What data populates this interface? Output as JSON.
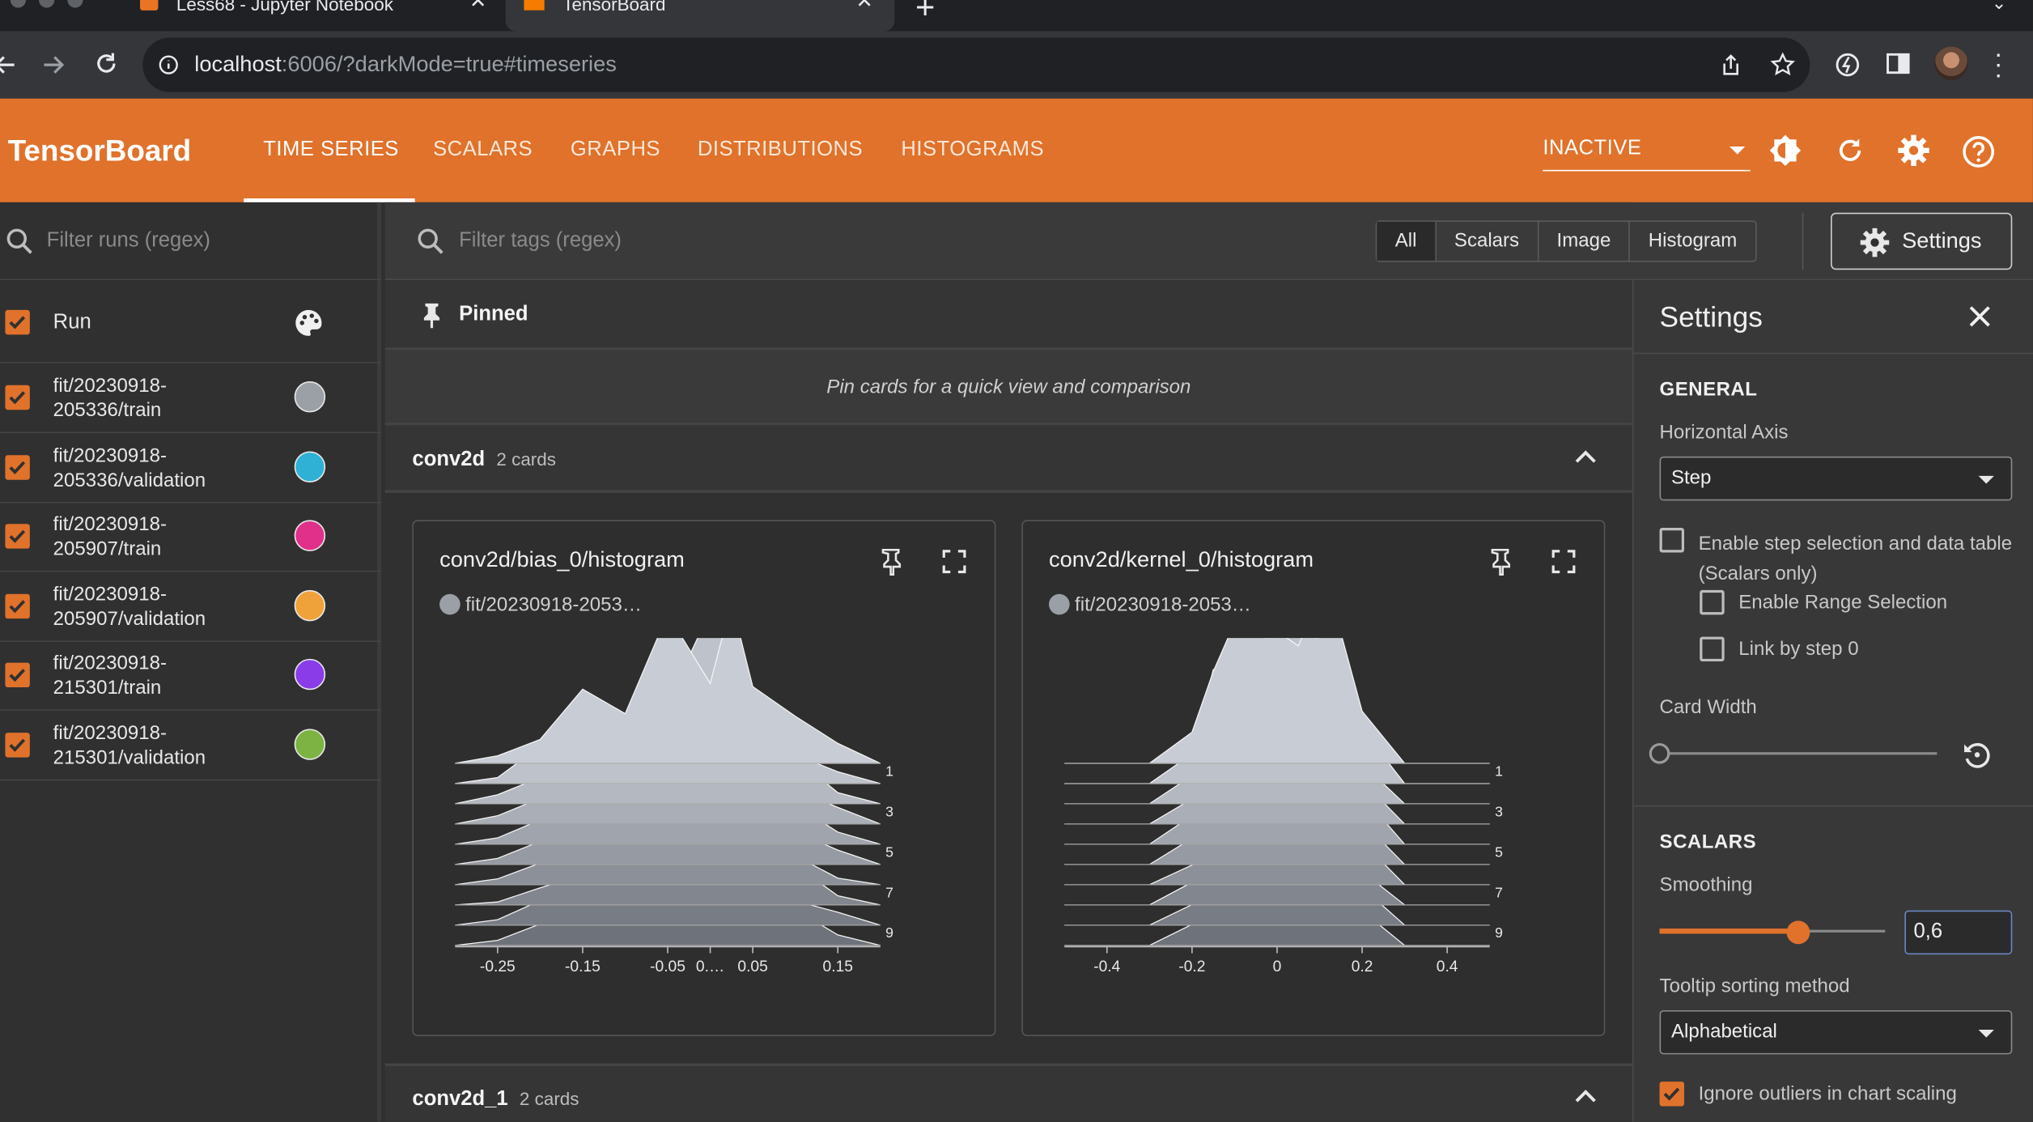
{
  "browser": {
    "tabs": [
      {
        "title": "Less68 - Jupyter Notebook"
      },
      {
        "title": "TensorBoard"
      }
    ],
    "url_host": "localhost",
    "url_rest": ":6006/?darkMode=true#timeseries"
  },
  "app": {
    "brand": "TensorBoard",
    "nav": [
      "TIME SERIES",
      "SCALARS",
      "GRAPHS",
      "DISTRIBUTIONS",
      "HISTOGRAMS"
    ],
    "active_nav": "TIME SERIES",
    "plugin_select": "INACTIVE",
    "colors": {
      "header": "#e0722b",
      "accent": "#e0722b",
      "background": "#303030"
    }
  },
  "runs": {
    "filter_placeholder": "Filter runs (regex)",
    "header": "Run",
    "items": [
      {
        "line1": "fit/20230918-",
        "line2": "205336/train",
        "color": "#9aa0a6",
        "checked": true
      },
      {
        "line1": "fit/20230918-",
        "line2": "205336/validation",
        "color": "#2fb0d5",
        "checked": true
      },
      {
        "line1": "fit/20230918-",
        "line2": "205907/train",
        "color": "#e0308a",
        "checked": true
      },
      {
        "line1": "fit/20230918-",
        "line2": "205907/validation",
        "color": "#f0a23a",
        "checked": true
      },
      {
        "line1": "fit/20230918-",
        "line2": "215301/train",
        "color": "#8a3ce8",
        "checked": true
      },
      {
        "line1": "fit/20230918-",
        "line2": "215301/validation",
        "color": "#7cb342",
        "checked": true
      }
    ]
  },
  "main": {
    "tag_filter_placeholder": "Filter tags (regex)",
    "type_filters": [
      "All",
      "Scalars",
      "Image",
      "Histogram"
    ],
    "selected_type": "All",
    "settings_button": "Settings",
    "pinned": {
      "title": "Pinned",
      "empty_text": "Pin cards for a quick view and comparison"
    },
    "groups": [
      {
        "name": "conv2d",
        "count": "2 cards"
      },
      {
        "name": "conv2d_1",
        "count": "2 cards"
      }
    ],
    "cards": [
      {
        "title": "conv2d/bias_0/histogram",
        "run": "fit/20230918-2053…"
      },
      {
        "title": "conv2d/kernel_0/histogram",
        "run": "fit/20230918-2053…"
      }
    ]
  },
  "chart_data": [
    {
      "type": "area",
      "title": "conv2d/bias_0/histogram",
      "series_run": "fit/20230918-2053…",
      "x_ticks": [
        "-0.25",
        "-0.15",
        "-0.05",
        "0.05",
        "0.15",
        "0.…"
      ],
      "step_ticks": [
        "1",
        "3",
        "5",
        "7",
        "9"
      ],
      "xlim": [
        -0.3,
        0.2
      ],
      "steps": [
        0,
        1,
        2,
        3,
        4,
        5,
        6,
        7,
        8,
        9
      ],
      "x": [
        -0.3,
        -0.25,
        -0.2,
        -0.15,
        -0.1,
        -0.05,
        0.0,
        0.025,
        0.05,
        0.1,
        0.15,
        0.2
      ],
      "shape": [
        0.0,
        0.05,
        0.18,
        0.35,
        0.55,
        0.75,
        0.9,
        1.0,
        0.65,
        0.3,
        0.1,
        0.0
      ]
    },
    {
      "type": "area",
      "title": "conv2d/kernel_0/histogram",
      "series_run": "fit/20230918-2053…",
      "x_ticks": [
        "-0.4",
        "-0.2",
        "0",
        "0.2",
        "0.4"
      ],
      "step_ticks": [
        "1",
        "3",
        "5",
        "7",
        "9"
      ],
      "xlim": [
        -0.5,
        0.5
      ],
      "steps": [
        0,
        1,
        2,
        3,
        4,
        5,
        6,
        7,
        8,
        9
      ],
      "x": [
        -0.5,
        -0.3,
        -0.2,
        -0.15,
        -0.1,
        -0.05,
        0.0,
        0.05,
        0.1,
        0.15,
        0.2,
        0.3,
        0.5
      ],
      "shape": [
        0.0,
        0.0,
        0.2,
        0.7,
        0.95,
        0.9,
        1.0,
        0.92,
        0.98,
        0.85,
        0.35,
        0.0,
        0.0
      ]
    }
  ],
  "settings": {
    "title": "Settings",
    "general": "GENERAL",
    "horizontal_axis_label": "Horizontal Axis",
    "horizontal_axis_value": "Step",
    "enable_step_selection": "Enable step selection and data table",
    "scalars_only": "(Scalars only)",
    "enable_range_selection": "Enable Range Selection",
    "link_by_step": "Link by step 0",
    "card_width_label": "Card Width",
    "card_width": 0,
    "scalars": "SCALARS",
    "smoothing_label": "Smoothing",
    "smoothing_value": "0,6",
    "smoothing": 0.6,
    "tooltip_sort_label": "Tooltip sorting method",
    "tooltip_sort_value": "Alphabetical",
    "ignore_outliers": "Ignore outliers in chart scaling"
  }
}
